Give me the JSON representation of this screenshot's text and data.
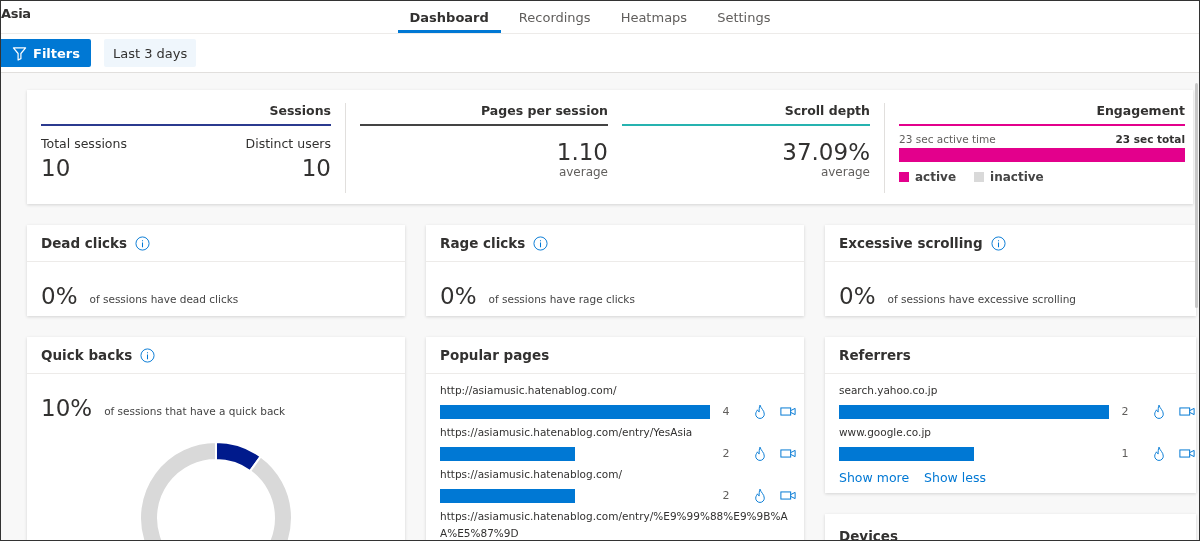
{
  "project": "Asia",
  "tabs": [
    {
      "label": "Dashboard",
      "selected": true
    },
    {
      "label": "Recordings",
      "selected": false
    },
    {
      "label": "Heatmaps",
      "selected": false
    },
    {
      "label": "Settings",
      "selected": false
    }
  ],
  "toolbar": {
    "filters_button": "Filters",
    "date_range": "Last 3 days"
  },
  "summary": {
    "sessions": {
      "title": "Sessions",
      "color": "#2b3a8f",
      "total_label": "Total sessions",
      "total": "10",
      "users_label": "Distinct users",
      "users": "10"
    },
    "pages_per_session": {
      "title": "Pages per session",
      "color": "#444444",
      "value": "1.10",
      "caption": "average"
    },
    "scroll_depth": {
      "title": "Scroll depth",
      "color": "#26b3b0",
      "value": "37.09%",
      "caption": "average"
    },
    "engagement": {
      "title": "Engagement",
      "color": "#e3008c",
      "active_time": "23 sec active time",
      "total": "23 sec total",
      "legend": [
        {
          "label": "active",
          "color": "#e3008c"
        },
        {
          "label": "inactive",
          "color": "#d9d9d9"
        }
      ]
    }
  },
  "metric_cards": [
    {
      "title": "Dead clicks",
      "value": "0%",
      "description": "of sessions have dead clicks"
    },
    {
      "title": "Rage clicks",
      "value": "0%",
      "description": "of sessions have rage clicks"
    },
    {
      "title": "Excessive scrolling",
      "value": "0%",
      "description": "of sessions have excessive scrolling"
    }
  ],
  "quick_backs": {
    "title": "Quick backs",
    "value": "10%",
    "description": "of sessions that have a quick back",
    "chart_data": {
      "type": "donut",
      "values": [
        10,
        90
      ],
      "colors": [
        "#001a8c",
        "#d9d9d9"
      ]
    }
  },
  "popular_pages": {
    "title": "Popular pages",
    "rows": [
      {
        "url": "http://asiamusic.hatenablog.com/",
        "count": "4"
      },
      {
        "url": "https://asiamusic.hatenablog.com/entry/YesAsia",
        "count": "2"
      },
      {
        "url": "https://asiamusic.hatenablog.com/",
        "count": "2"
      },
      {
        "url": "https://asiamusic.hatenablog.com/entry/%E9%99%88%E9%9B%AA%E5%87%9D"
      }
    ]
  },
  "referrers": {
    "title": "Referrers",
    "rows": [
      {
        "url": "search.yahoo.co.jp",
        "count": "2"
      },
      {
        "url": "www.google.co.jp",
        "count": "1"
      }
    ],
    "show_more": "Show more",
    "show_less": "Show less"
  },
  "devices": {
    "title": "Devices"
  }
}
